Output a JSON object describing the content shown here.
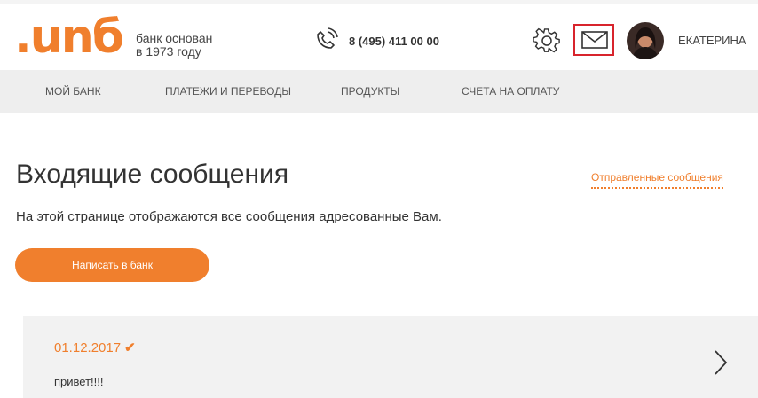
{
  "header": {
    "logo_text": ".unб",
    "tagline_line1": "банк основан",
    "tagline_line2": "в 1973 году",
    "phone": "8 (495) 411 00 00",
    "user_name": "ЕКАТЕРИНА",
    "icons": [
      "phone-icon",
      "gear-icon",
      "mail-icon",
      "avatar"
    ]
  },
  "nav": {
    "items": [
      {
        "label": "МОЙ БАНК"
      },
      {
        "label": "ПЛАТЕЖИ И ПЕРЕВОДЫ"
      },
      {
        "label": "ПРОДУКТЫ"
      },
      {
        "label": "СЧЕТА НА ОПЛАТУ"
      }
    ]
  },
  "main": {
    "title": "Входящие сообщения",
    "sent_link": "Отправленные сообщения",
    "subtitle": "На этой странице отображаются все сообщения адресованные Вам.",
    "write_button": "Написать в банк"
  },
  "messages": [
    {
      "date": "01.12.2017",
      "check": "✔",
      "text": "привет!!!!"
    }
  ],
  "colors": {
    "accent": "#f07f2d",
    "highlight": "#d8242c",
    "nav_bg": "#eeeeee",
    "card_bg": "#f2f2f2"
  }
}
